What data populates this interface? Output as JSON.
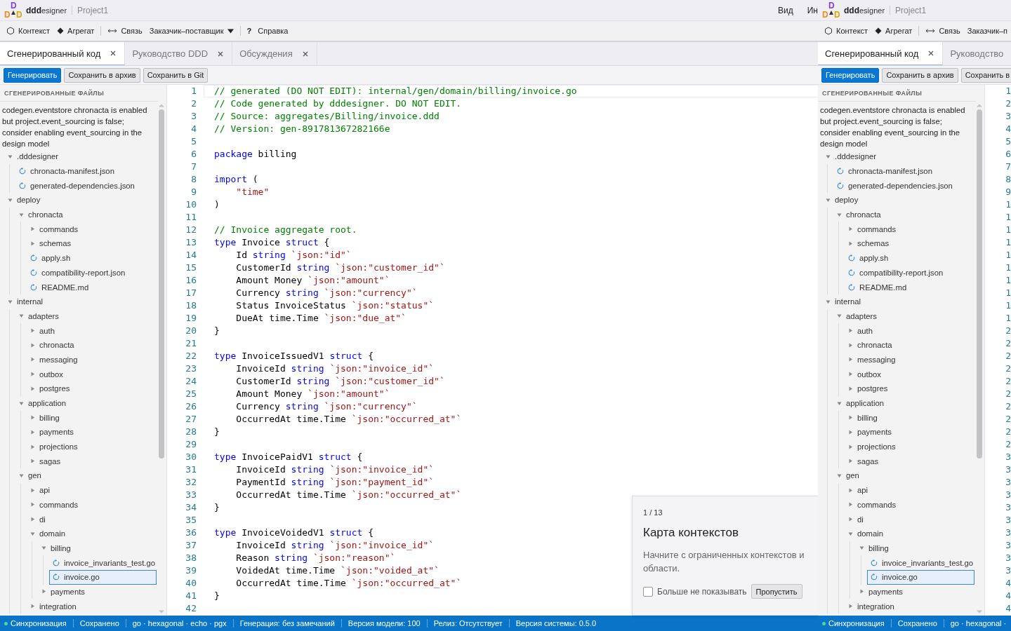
{
  "app": {
    "header": {
      "logo_letters": [
        "D",
        "D",
        "D"
      ],
      "brand": "**ddd**esigner",
      "project": "Project1",
      "menu": [
        "Вид",
        "Ин"
      ]
    },
    "toolbar": [
      {
        "kind": "hexagon",
        "label": "Контекст"
      },
      {
        "kind": "diamond",
        "label": "Агрегат"
      },
      {
        "kind": "separator"
      },
      {
        "kind": "link",
        "label": "Связь"
      },
      {
        "kind": "dropdown",
        "label": "Заказчик–поставщик"
      },
      {
        "kind": "separator"
      },
      {
        "kind": "help",
        "glyph": "?",
        "label": "Справка"
      }
    ],
    "tabs": [
      {
        "label": "Сгенерированный код",
        "selected": true,
        "closable": true
      },
      {
        "label": "Руководство DDD",
        "selected": false,
        "closable": true
      },
      {
        "label": "Обсуждения",
        "selected": false,
        "closable": true
      }
    ],
    "actions": [
      {
        "label": "Генерировать",
        "kind": "primary"
      },
      {
        "label": "Сохранить в архив",
        "kind": "secondary"
      },
      {
        "label": "Сохранить в Git",
        "kind": "secondary"
      }
    ],
    "sidebar": {
      "title": "СГЕНЕРИРОВАННЫЕ ФАЙЛЫ",
      "message": "codegen.eventstore chronacta is enabled but project.event_sourcing is false; consider enabling event_sourcing in the design model",
      "tree": [
        {
          "label": ".dddesigner",
          "kind": "folder",
          "expanded": true,
          "selected": false,
          "children": [
            {
              "label": "chronacta-manifest.json",
              "kind": "file",
              "selected": false
            },
            {
              "label": "generated-dependencies.json",
              "kind": "file",
              "selected": false
            }
          ]
        },
        {
          "label": "deploy",
          "kind": "folder",
          "expanded": true,
          "selected": false,
          "children": [
            {
              "label": "chronacta",
              "kind": "folder",
              "expanded": true,
              "selected": false,
              "children": [
                {
                  "label": "commands",
                  "kind": "folder",
                  "expanded": false,
                  "selected": false
                },
                {
                  "label": "schemas",
                  "kind": "folder",
                  "expanded": false,
                  "selected": false
                },
                {
                  "label": "apply.sh",
                  "kind": "file",
                  "selected": false
                },
                {
                  "label": "compatibility-report.json",
                  "kind": "file",
                  "selected": false
                },
                {
                  "label": "README.md",
                  "kind": "file",
                  "selected": false
                }
              ]
            }
          ]
        },
        {
          "label": "internal",
          "kind": "folder",
          "expanded": true,
          "selected": false,
          "children": [
            {
              "label": "adapters",
              "kind": "folder",
              "expanded": true,
              "selected": false,
              "children": [
                {
                  "label": "auth",
                  "kind": "folder",
                  "expanded": false,
                  "selected": false
                },
                {
                  "label": "chronacta",
                  "kind": "folder",
                  "expanded": false,
                  "selected": false
                },
                {
                  "label": "messaging",
                  "kind": "folder",
                  "expanded": false,
                  "selected": false
                },
                {
                  "label": "outbox",
                  "kind": "folder",
                  "expanded": false,
                  "selected": false
                },
                {
                  "label": "postgres",
                  "kind": "folder",
                  "expanded": false,
                  "selected": false
                }
              ]
            },
            {
              "label": "application",
              "kind": "folder",
              "expanded": true,
              "selected": false,
              "children": [
                {
                  "label": "billing",
                  "kind": "folder",
                  "expanded": false,
                  "selected": false
                },
                {
                  "label": "payments",
                  "kind": "folder",
                  "expanded": false,
                  "selected": false
                },
                {
                  "label": "projections",
                  "kind": "folder",
                  "expanded": false,
                  "selected": false
                },
                {
                  "label": "sagas",
                  "kind": "folder",
                  "expanded": false,
                  "selected": false
                }
              ]
            },
            {
              "label": "gen",
              "kind": "folder",
              "expanded": true,
              "selected": false,
              "children": [
                {
                  "label": "api",
                  "kind": "folder",
                  "expanded": false,
                  "selected": false
                },
                {
                  "label": "commands",
                  "kind": "folder",
                  "expanded": false,
                  "selected": false
                },
                {
                  "label": "di",
                  "kind": "folder",
                  "expanded": false,
                  "selected": false
                },
                {
                  "label": "domain",
                  "kind": "folder",
                  "expanded": true,
                  "selected": false,
                  "children": [
                    {
                      "label": "billing",
                      "kind": "folder",
                      "expanded": true,
                      "selected": false,
                      "children": [
                        {
                          "label": "invoice_invariants_test.go",
                          "kind": "file",
                          "selected": false
                        },
                        {
                          "label": "invoice.go",
                          "kind": "file",
                          "selected": true
                        }
                      ]
                    },
                    {
                      "label": "payments",
                      "kind": "folder",
                      "expanded": false,
                      "selected": false
                    }
                  ]
                },
                {
                  "label": "integration",
                  "kind": "folder",
                  "expanded": false,
                  "selected": false
                }
              ]
            }
          ]
        }
      ]
    },
    "editor": {
      "lines": [
        {
          "n": "1",
          "current": true,
          "t": [
            {
              "kind": "comment",
              "text": "// generated (DO NOT EDIT): internal/gen/domain/billing/invoice.go"
            }
          ]
        },
        {
          "n": "2",
          "current": false,
          "t": [
            {
              "kind": "comment",
              "text": "// Code generated by dddesigner. DO NOT EDIT."
            }
          ]
        },
        {
          "n": "3",
          "current": false,
          "t": [
            {
              "kind": "comment",
              "text": "// Source: aggregates/Billing/invoice.ddd"
            }
          ]
        },
        {
          "n": "4",
          "current": false,
          "t": [
            {
              "kind": "comment",
              "text": "// Version: gen-891781367282166e"
            }
          ]
        },
        {
          "n": "5",
          "current": false
        },
        {
          "n": "6",
          "current": false,
          "t": [
            {
              "kind": "keyword",
              "text": "package"
            },
            {
              "kind": "plain",
              "text": " billing"
            }
          ]
        },
        {
          "n": "7",
          "current": false
        },
        {
          "n": "8",
          "current": false,
          "t": [
            {
              "kind": "keyword",
              "text": "import"
            },
            {
              "kind": "plain",
              "text": " ("
            }
          ]
        },
        {
          "n": "9",
          "current": false,
          "t": [
            {
              "kind": "string",
              "text": "    \"time\""
            }
          ]
        },
        {
          "n": "10",
          "current": false,
          "t": [
            {
              "kind": "plain",
              "text": ")"
            }
          ]
        },
        {
          "n": "11",
          "current": false
        },
        {
          "n": "12",
          "current": false,
          "t": [
            {
              "kind": "comment",
              "text": "// Invoice aggregate root."
            }
          ]
        },
        {
          "n": "13",
          "current": false,
          "t": [
            {
              "kind": "keyword",
              "text": "type"
            },
            {
              "kind": "plain",
              "text": " Invoice "
            },
            {
              "kind": "keyword",
              "text": "struct"
            },
            {
              "kind": "plain",
              "text": " {"
            }
          ]
        },
        {
          "n": "14",
          "current": false,
          "t": [
            {
              "kind": "plain",
              "text": "    Id "
            },
            {
              "kind": "keyword",
              "text": "string "
            },
            {
              "kind": "string",
              "text": "`json:\"id\"`"
            }
          ]
        },
        {
          "n": "15",
          "current": false,
          "t": [
            {
              "kind": "plain",
              "text": "    CustomerId "
            },
            {
              "kind": "keyword",
              "text": "string "
            },
            {
              "kind": "string",
              "text": "`json:\"customer_id\"`"
            }
          ]
        },
        {
          "n": "16",
          "current": false,
          "t": [
            {
              "kind": "plain",
              "text": "    Amount Money "
            },
            {
              "kind": "string",
              "text": "`json:\"amount\"`"
            }
          ]
        },
        {
          "n": "17",
          "current": false,
          "t": [
            {
              "kind": "plain",
              "text": "    Currency "
            },
            {
              "kind": "keyword",
              "text": "string "
            },
            {
              "kind": "string",
              "text": "`json:\"currency\"`"
            }
          ]
        },
        {
          "n": "18",
          "current": false,
          "t": [
            {
              "kind": "plain",
              "text": "    Status InvoiceStatus "
            },
            {
              "kind": "string",
              "text": "`json:\"status\"`"
            }
          ]
        },
        {
          "n": "19",
          "current": false,
          "t": [
            {
              "kind": "plain",
              "text": "    DueAt time.Time "
            },
            {
              "kind": "string",
              "text": "`json:\"due_at\"`"
            }
          ]
        },
        {
          "n": "20",
          "current": false,
          "t": [
            {
              "kind": "plain",
              "text": "}"
            }
          ]
        },
        {
          "n": "21",
          "current": false
        },
        {
          "n": "22",
          "current": false,
          "t": [
            {
              "kind": "keyword",
              "text": "type"
            },
            {
              "kind": "plain",
              "text": " InvoiceIssuedV1 "
            },
            {
              "kind": "keyword",
              "text": "struct"
            },
            {
              "kind": "plain",
              "text": " {"
            }
          ]
        },
        {
          "n": "23",
          "current": false,
          "t": [
            {
              "kind": "plain",
              "text": "    InvoiceId "
            },
            {
              "kind": "keyword",
              "text": "string "
            },
            {
              "kind": "string",
              "text": "`json:\"invoice_id\"`"
            }
          ]
        },
        {
          "n": "24",
          "current": false,
          "t": [
            {
              "kind": "plain",
              "text": "    CustomerId "
            },
            {
              "kind": "keyword",
              "text": "string "
            },
            {
              "kind": "string",
              "text": "`json:\"customer_id\"`"
            }
          ]
        },
        {
          "n": "25",
          "current": false,
          "t": [
            {
              "kind": "plain",
              "text": "    Amount Money "
            },
            {
              "kind": "string",
              "text": "`json:\"amount\"`"
            }
          ]
        },
        {
          "n": "26",
          "current": false,
          "t": [
            {
              "kind": "plain",
              "text": "    Currency "
            },
            {
              "kind": "keyword",
              "text": "string "
            },
            {
              "kind": "string",
              "text": "`json:\"currency\"`"
            }
          ]
        },
        {
          "n": "27",
          "current": false,
          "t": [
            {
              "kind": "plain",
              "text": "    OccurredAt time.Time "
            },
            {
              "kind": "string",
              "text": "`json:\"occurred_at\"`"
            }
          ]
        },
        {
          "n": "28",
          "current": false,
          "t": [
            {
              "kind": "plain",
              "text": "}"
            }
          ]
        },
        {
          "n": "29",
          "current": false
        },
        {
          "n": "30",
          "current": false,
          "t": [
            {
              "kind": "keyword",
              "text": "type"
            },
            {
              "kind": "plain",
              "text": " InvoicePaidV1 "
            },
            {
              "kind": "keyword",
              "text": "struct"
            },
            {
              "kind": "plain",
              "text": " {"
            }
          ]
        },
        {
          "n": "31",
          "current": false,
          "t": [
            {
              "kind": "plain",
              "text": "    InvoiceId "
            },
            {
              "kind": "keyword",
              "text": "string "
            },
            {
              "kind": "string",
              "text": "`json:\"invoice_id\"`"
            }
          ]
        },
        {
          "n": "32",
          "current": false,
          "t": [
            {
              "kind": "plain",
              "text": "    PaymentId "
            },
            {
              "kind": "keyword",
              "text": "string "
            },
            {
              "kind": "string",
              "text": "`json:\"payment_id\"`"
            }
          ]
        },
        {
          "n": "33",
          "current": false,
          "t": [
            {
              "kind": "plain",
              "text": "    OccurredAt time.Time "
            },
            {
              "kind": "string",
              "text": "`json:\"occurred_at\"`"
            }
          ]
        },
        {
          "n": "34",
          "current": false,
          "t": [
            {
              "kind": "plain",
              "text": "}"
            }
          ]
        },
        {
          "n": "35",
          "current": false
        },
        {
          "n": "36",
          "current": false,
          "t": [
            {
              "kind": "keyword",
              "text": "type"
            },
            {
              "kind": "plain",
              "text": " InvoiceVoidedV1 "
            },
            {
              "kind": "keyword",
              "text": "struct"
            },
            {
              "kind": "plain",
              "text": " {"
            }
          ]
        },
        {
          "n": "37",
          "current": false,
          "t": [
            {
              "kind": "plain",
              "text": "    InvoiceId "
            },
            {
              "kind": "keyword",
              "text": "string "
            },
            {
              "kind": "string",
              "text": "`json:\"invoice_id\"`"
            }
          ]
        },
        {
          "n": "38",
          "current": false,
          "t": [
            {
              "kind": "plain",
              "text": "    Reason "
            },
            {
              "kind": "keyword",
              "text": "string "
            },
            {
              "kind": "string",
              "text": "`json:\"reason\"`"
            }
          ]
        },
        {
          "n": "39",
          "current": false,
          "t": [
            {
              "kind": "plain",
              "text": "    VoidedAt time.Time "
            },
            {
              "kind": "string",
              "text": "`json:\"voided_at\"`"
            }
          ]
        },
        {
          "n": "40",
          "current": false,
          "t": [
            {
              "kind": "plain",
              "text": "    OccurredAt time.Time "
            },
            {
              "kind": "string",
              "text": "`json:\"occurred_at\"`"
            }
          ]
        },
        {
          "n": "41",
          "current": false,
          "t": [
            {
              "kind": "plain",
              "text": "}"
            }
          ]
        },
        {
          "n": "42",
          "current": false
        }
      ]
    },
    "tour_popup": {
      "counter": "1 / 13",
      "title": "Карта контекстов",
      "body_lines": [
        "Начните с ограниченных контекстов и",
        "области."
      ],
      "dont_show": {
        "label": "Больше не показывать",
        "checked": false
      },
      "skip_button": "Пропустить"
    },
    "status_bar": [
      {
        "kind": "sync",
        "label": "Синхронизация"
      },
      {
        "kind": "text",
        "label": "Сохранено"
      },
      {
        "kind": "text",
        "label": "go · hexagonal · echo · pgx"
      },
      {
        "kind": "text",
        "label": "Генерация: без замечаний"
      },
      {
        "kind": "text",
        "label": "Версия модели: 100"
      },
      {
        "kind": "text",
        "label": "Релиз: Отсутствует"
      },
      {
        "kind": "text",
        "label": "Версия системы: 0.5.0"
      }
    ]
  },
  "overlay_copy": {
    "header": {
      "logo_letters": [
        "D",
        "D",
        "D"
      ],
      "brand": "**ddd**esigner",
      "project": "Project1"
    },
    "toolbar": [
      {
        "kind": "hexagon",
        "label": "Контекст"
      },
      {
        "kind": "diamond",
        "label": "Агрегат"
      },
      {
        "kind": "separator"
      },
      {
        "kind": "link",
        "label": "Связь"
      },
      {
        "kind": "plain",
        "label": "Заказчик–п"
      }
    ],
    "tabs": [
      {
        "label": "Сгенерированный код",
        "selected": true,
        "closable": true
      },
      {
        "label": "Руководство",
        "selected": false,
        "closable": false
      }
    ],
    "actions": [
      {
        "label": "Генерировать",
        "kind": "primary"
      },
      {
        "label": "Сохранить в архив",
        "kind": "secondary"
      },
      {
        "label": "Сохранить в",
        "kind": "secondary"
      }
    ],
    "sidebar": {
      "title": "СГЕНЕРИРОВАННЫЕ ФАЙЛЫ",
      "message": "codegen.eventstore chronacta is enabled but project.event_sourcing is false; consider enabling event_sourcing in the design model",
      "tree": [
        {
          "label": ".dddesigner",
          "kind": "folder",
          "expanded": true,
          "selected": false,
          "children": [
            {
              "label": "chronacta-manifest.json",
              "kind": "file",
              "selected": false
            },
            {
              "label": "generated-dependencies.json",
              "kind": "file",
              "selected": false
            }
          ]
        },
        {
          "label": "deploy",
          "kind": "folder",
          "expanded": true,
          "selected": false,
          "children": [
            {
              "label": "chronacta",
              "kind": "folder",
              "expanded": true,
              "selected": false,
              "children": [
                {
                  "label": "commands",
                  "kind": "folder",
                  "expanded": false,
                  "selected": false
                },
                {
                  "label": "schemas",
                  "kind": "folder",
                  "expanded": false,
                  "selected": false
                },
                {
                  "label": "apply.sh",
                  "kind": "file",
                  "selected": false
                },
                {
                  "label": "compatibility-report.json",
                  "kind": "file",
                  "selected": false
                },
                {
                  "label": "README.md",
                  "kind": "file",
                  "selected": false
                }
              ]
            }
          ]
        },
        {
          "label": "internal",
          "kind": "folder",
          "expanded": true,
          "selected": false,
          "children": [
            {
              "label": "adapters",
              "kind": "folder",
              "expanded": true,
              "selected": false,
              "children": [
                {
                  "label": "auth",
                  "kind": "folder",
                  "expanded": false,
                  "selected": false
                },
                {
                  "label": "chronacta",
                  "kind": "folder",
                  "expanded": false,
                  "selected": false
                },
                {
                  "label": "messaging",
                  "kind": "folder",
                  "expanded": false,
                  "selected": false
                },
                {
                  "label": "outbox",
                  "kind": "folder",
                  "expanded": false,
                  "selected": false
                },
                {
                  "label": "postgres",
                  "kind": "folder",
                  "expanded": false,
                  "selected": false
                }
              ]
            },
            {
              "label": "application",
              "kind": "folder",
              "expanded": true,
              "selected": false,
              "children": [
                {
                  "label": "billing",
                  "kind": "folder",
                  "expanded": false,
                  "selected": false
                },
                {
                  "label": "payments",
                  "kind": "folder",
                  "expanded": false,
                  "selected": false
                },
                {
                  "label": "projections",
                  "kind": "folder",
                  "expanded": false,
                  "selected": false
                },
                {
                  "label": "sagas",
                  "kind": "folder",
                  "expanded": false,
                  "selected": false
                }
              ]
            },
            {
              "label": "gen",
              "kind": "folder",
              "expanded": true,
              "selected": false,
              "children": [
                {
                  "label": "api",
                  "kind": "folder",
                  "expanded": false,
                  "selected": false
                },
                {
                  "label": "commands",
                  "kind": "folder",
                  "expanded": false,
                  "selected": false
                },
                {
                  "label": "di",
                  "kind": "folder",
                  "expanded": false,
                  "selected": false
                },
                {
                  "label": "domain",
                  "kind": "folder",
                  "expanded": true,
                  "selected": false,
                  "children": [
                    {
                      "label": "billing",
                      "kind": "folder",
                      "expanded": true,
                      "selected": false,
                      "children": [
                        {
                          "label": "invoice_invariants_test.go",
                          "kind": "file",
                          "selected": false
                        },
                        {
                          "label": "invoice.go",
                          "kind": "file",
                          "selected": true
                        }
                      ]
                    },
                    {
                      "label": "payments",
                      "kind": "folder",
                      "expanded": false,
                      "selected": false
                    }
                  ]
                },
                {
                  "label": "integration",
                  "kind": "folder",
                  "expanded": false,
                  "selected": false
                }
              ]
            }
          ]
        }
      ]
    },
    "line_numbers": [
      "1",
      "2",
      "3",
      "4",
      "5",
      "6",
      "7",
      "8",
      "9",
      "1",
      "1",
      "1",
      "1",
      "1",
      "1",
      "1",
      "1",
      "1",
      "1",
      "2",
      "2",
      "2",
      "2",
      "2",
      "2",
      "2",
      "2",
      "2",
      "2",
      "3",
      "3",
      "3",
      "3",
      "3",
      "3",
      "3",
      "3",
      "3",
      "3",
      "4",
      "4",
      "4"
    ],
    "status_bar": [
      {
        "kind": "sync",
        "label": "Синхронизация"
      },
      {
        "kind": "text",
        "label": "Сохранено"
      },
      {
        "kind": "text",
        "label": "go · hexagonal ·"
      }
    ]
  }
}
